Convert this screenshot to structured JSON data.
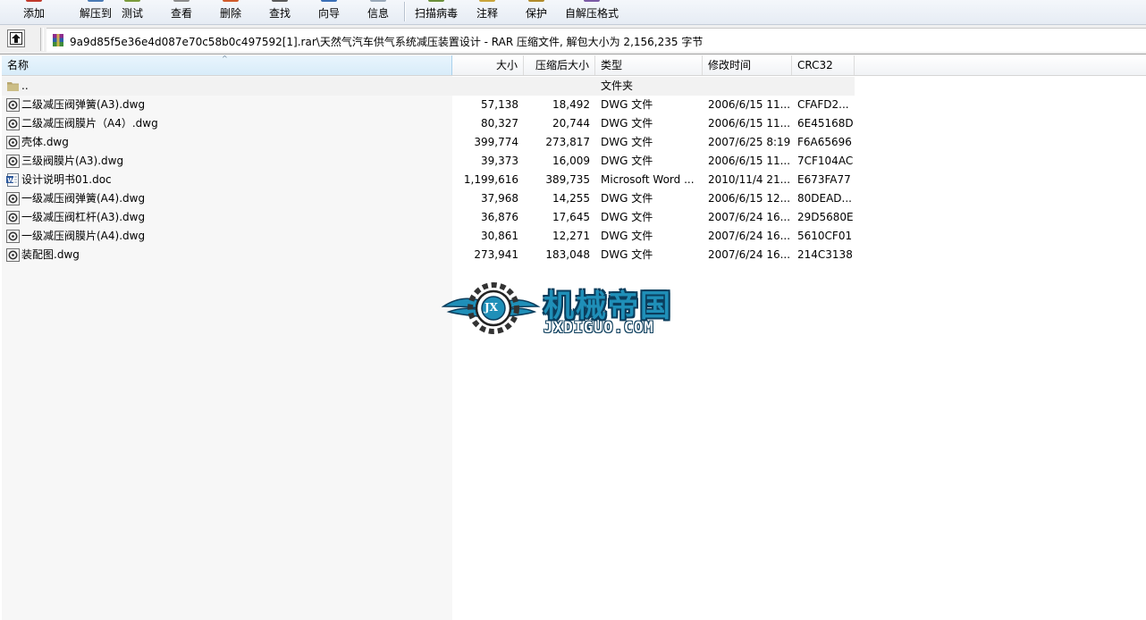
{
  "toolbar": {
    "buttons": [
      {
        "label": "添加",
        "icon": "add-archive-icon"
      },
      {
        "label": "解压到",
        "icon": "extract-to-icon"
      },
      {
        "label": "测试",
        "icon": "test-icon"
      },
      {
        "label": "查看",
        "icon": "view-icon"
      },
      {
        "label": "删除",
        "icon": "delete-icon"
      },
      {
        "label": "查找",
        "icon": "find-icon"
      },
      {
        "label": "向导",
        "icon": "wizard-icon"
      },
      {
        "label": "信息",
        "icon": "info-icon"
      },
      {
        "label": "扫描病毒",
        "icon": "virus-scan-icon"
      },
      {
        "label": "注释",
        "icon": "comment-icon"
      },
      {
        "label": "保护",
        "icon": "protect-icon"
      },
      {
        "label": "自解压格式",
        "icon": "sfx-icon"
      }
    ]
  },
  "address": {
    "path": "9a9d85f5e36e4d087e70c58b0c497592[1].rar\\天然气汽车供气系统减压装置设计 - RAR 压缩文件, 解包大小为 2,156,235 字节"
  },
  "columns": {
    "name": "名称",
    "size": "大小",
    "packed": "压缩后大小",
    "type": "类型",
    "modified": "修改时间",
    "crc": "CRC32"
  },
  "parent_row": {
    "name": "..",
    "type": "文件夹"
  },
  "files": [
    {
      "name": "二级减压阀弹簧(A3).dwg",
      "size": "57,138",
      "packed": "18,492",
      "type": "DWG 文件",
      "modified": "2006/6/15 11...",
      "crc": "CFAFD2...",
      "kind": "dwg"
    },
    {
      "name": "二级减压阀膜片（A4）.dwg",
      "size": "80,327",
      "packed": "20,744",
      "type": "DWG 文件",
      "modified": "2006/6/15 11...",
      "crc": "6E45168D",
      "kind": "dwg"
    },
    {
      "name": "壳体.dwg",
      "size": "399,774",
      "packed": "273,817",
      "type": "DWG 文件",
      "modified": "2007/6/25 8:19",
      "crc": "F6A65696",
      "kind": "dwg"
    },
    {
      "name": "三级阀膜片(A3).dwg",
      "size": "39,373",
      "packed": "16,009",
      "type": "DWG 文件",
      "modified": "2006/6/15 11...",
      "crc": "7CF104AC",
      "kind": "dwg"
    },
    {
      "name": "设计说明书01.doc",
      "size": "1,199,616",
      "packed": "389,735",
      "type": "Microsoft Word ...",
      "modified": "2010/11/4 21...",
      "crc": "E673FA77",
      "kind": "doc"
    },
    {
      "name": "一级减压阀弹簧(A4).dwg",
      "size": "37,968",
      "packed": "14,255",
      "type": "DWG 文件",
      "modified": "2006/6/15 12...",
      "crc": "80DEAD...",
      "kind": "dwg"
    },
    {
      "name": "一级减压阀杠杆(A3).dwg",
      "size": "36,876",
      "packed": "17,645",
      "type": "DWG 文件",
      "modified": "2007/6/24 16...",
      "crc": "29D5680E",
      "kind": "dwg"
    },
    {
      "name": "一级减压阀膜片(A4).dwg",
      "size": "30,861",
      "packed": "12,271",
      "type": "DWG 文件",
      "modified": "2007/6/24 16...",
      "crc": "5610CF01",
      "kind": "dwg"
    },
    {
      "name": "装配图.dwg",
      "size": "273,941",
      "packed": "183,048",
      "type": "DWG 文件",
      "modified": "2007/6/24 16...",
      "crc": "214C3138",
      "kind": "dwg"
    }
  ],
  "watermark": {
    "title": "机械帝国",
    "url": "JXDIGUO.COM",
    "badge": "JX"
  },
  "colors": {
    "accent": "#1f8fb8",
    "watermark_dark": "#0b3d5c",
    "sorted_column": "#d8ecf9"
  }
}
